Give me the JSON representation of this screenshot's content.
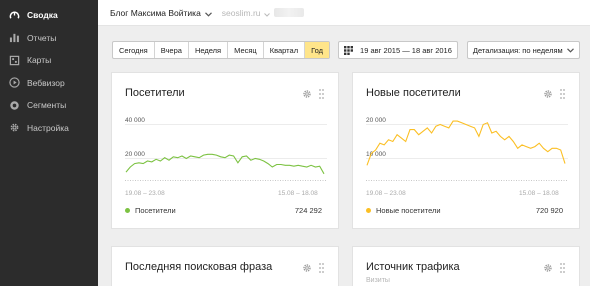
{
  "sidebar": {
    "items": [
      {
        "label": "Сводка",
        "icon": "gauge-icon",
        "active": true
      },
      {
        "label": "Отчеты",
        "icon": "bar-chart-icon",
        "active": false
      },
      {
        "label": "Карты",
        "icon": "map-icon",
        "active": false
      },
      {
        "label": "Вебвизор",
        "icon": "play-icon",
        "active": false
      },
      {
        "label": "Сегменты",
        "icon": "circle-icon",
        "active": false
      },
      {
        "label": "Настройка",
        "icon": "gear-icon",
        "active": false
      }
    ]
  },
  "header": {
    "site_title": "Блог Максима Войтика",
    "domain": "seoslim.ru"
  },
  "toolbar": {
    "periods": [
      "Сегодня",
      "Вчера",
      "Неделя",
      "Месяц",
      "Квартал",
      "Год"
    ],
    "active_period": "Год",
    "date_range": "19 авг 2015 — 18 авг 2016",
    "detail": "Детализация: по неделям"
  },
  "colors": {
    "green": "#7cc242",
    "yellow": "#fbbf24",
    "active_period_bg": "#ffe58a",
    "sidebar_bg": "#2c2c2c"
  },
  "cards": {
    "visitors": {
      "title": "Посетители",
      "legend": "Посетители",
      "total": "724 292",
      "y_ticks": [
        "40 000",
        "20 000"
      ],
      "x_start": "19.08 – 23.08",
      "x_end": "15.08 – 18.08"
    },
    "new_visitors": {
      "title": "Новые посетители",
      "legend": "Новые посетители",
      "total": "720 920",
      "y_ticks": [
        "20 000",
        "10 000"
      ],
      "x_start": "19.08 – 23.08",
      "x_end": "15.08 – 18.08"
    },
    "last_search": {
      "title": "Последняя поисковая фраза"
    },
    "traffic_source": {
      "title": "Источник трафика",
      "subtitle": "Визиты"
    }
  },
  "chart_data": [
    {
      "type": "line",
      "ylim": [
        0,
        40000
      ],
      "series": [
        {
          "name": "Посетители",
          "values": [
            12000,
            15000,
            17000,
            17500,
            17000,
            18500,
            18000,
            19500,
            18500,
            20500,
            19000,
            21000,
            20500,
            21500,
            20000,
            21500,
            21000,
            20500,
            22000,
            22500,
            22500,
            22000,
            21000,
            20500,
            22000,
            21500,
            17500,
            21000,
            21500,
            19000,
            20000,
            19500,
            18500,
            17000,
            15000,
            16500,
            16500,
            16000,
            16000,
            15500,
            16000,
            15500,
            15000,
            16000,
            15000,
            15500,
            11000
          ]
        }
      ]
    },
    {
      "type": "line",
      "ylim": [
        0,
        22000
      ],
      "series": [
        {
          "name": "Новые посетители",
          "values": [
            8000,
            11500,
            12500,
            14500,
            14000,
            15500,
            15000,
            17000,
            16000,
            15000,
            18500,
            18500,
            17000,
            18000,
            19000,
            17500,
            19500,
            20000,
            19500,
            19000,
            21000,
            21000,
            20500,
            20000,
            19500,
            19000,
            16500,
            20000,
            20500,
            17500,
            18000,
            16500,
            15500,
            16500,
            15000,
            13000,
            14000,
            13500,
            13000,
            13500,
            14500,
            13000,
            12000,
            13000,
            13000,
            12500,
            8500
          ]
        }
      ]
    }
  ]
}
